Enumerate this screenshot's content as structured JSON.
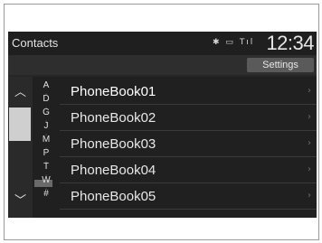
{
  "header": {
    "title": "Contacts",
    "clock": "12:34",
    "status_icons": [
      "bluetooth-icon",
      "battery-icon",
      "signal-icon"
    ],
    "bluetooth_glyph": "✱",
    "battery_glyph": "▭",
    "signal_glyph": "Tıl"
  },
  "toolbar": {
    "settings_label": "Settings"
  },
  "scroll": {
    "up_glyph": "︿",
    "down_glyph": "﹀"
  },
  "index": {
    "letters": [
      "A",
      "D",
      "G",
      "J",
      "M",
      "P",
      "T",
      "W",
      "#"
    ]
  },
  "list": {
    "items": [
      {
        "label": "PhoneBook01"
      },
      {
        "label": "PhoneBook02"
      },
      {
        "label": "PhoneBook03"
      },
      {
        "label": "PhoneBook04"
      },
      {
        "label": "PhoneBook05"
      }
    ],
    "chevron": "›"
  },
  "colors": {
    "screen_bg": "#262626",
    "button_bg": "#5a5a5a",
    "text": "#e8e8e8"
  }
}
